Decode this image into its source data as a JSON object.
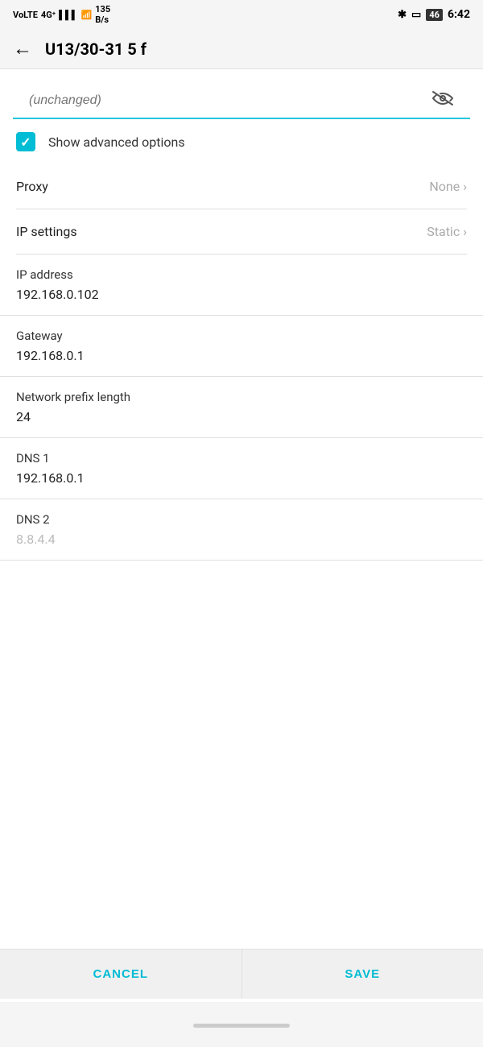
{
  "statusBar": {
    "leftItems": "VoLTE 4G+ 135 B/s",
    "bluetooth": "✱",
    "time": "6:42"
  },
  "appBar": {
    "backIcon": "←",
    "title": "U13/30-31 5 f"
  },
  "passwordField": {
    "placeholder": "(unchanged)",
    "eyeIcon": "eye-off"
  },
  "advancedOptions": {
    "checkboxLabel": "Show advanced options",
    "checked": true
  },
  "proxy": {
    "label": "Proxy",
    "value": "None"
  },
  "ipSettings": {
    "label": "IP settings",
    "value": "Static"
  },
  "ipAddress": {
    "label": "IP address",
    "value": "192.168.0.102"
  },
  "gateway": {
    "label": "Gateway",
    "value": "192.168.0.1"
  },
  "networkPrefixLength": {
    "label": "Network prefix length",
    "value": "24"
  },
  "dns1": {
    "label": "DNS 1",
    "value": "192.168.0.1"
  },
  "dns2": {
    "label": "DNS 2",
    "value": "8.8.4.4",
    "isPlaceholder": true
  },
  "buttons": {
    "cancel": "CANCEL",
    "save": "SAVE"
  }
}
